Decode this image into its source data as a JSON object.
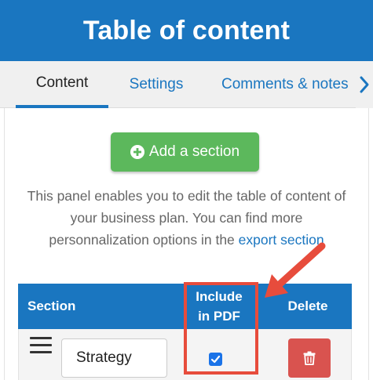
{
  "header": {
    "title": "Table of content"
  },
  "tabs": [
    {
      "label": "Content",
      "active": true
    },
    {
      "label": "Settings",
      "active": false
    },
    {
      "label": "Comments & notes",
      "active": false
    }
  ],
  "add_section": {
    "label": "Add a section",
    "icon": "plus-circle-icon"
  },
  "info": {
    "text": "This panel enables you to edit the table of content of your business plan. You can find more personnalization options in the ",
    "link": "export section"
  },
  "table": {
    "headers": {
      "section": "Section",
      "pdf_line1": "Include",
      "pdf_line2": "in PDF",
      "delete": "Delete"
    },
    "rows": [
      {
        "section_value": "Strategy",
        "include_in_pdf": true
      }
    ]
  },
  "colors": {
    "brand_blue": "#1a76c0",
    "add_green": "#5cb85c",
    "delete_red": "#d9534f",
    "annotation_red": "#e74c3c"
  }
}
